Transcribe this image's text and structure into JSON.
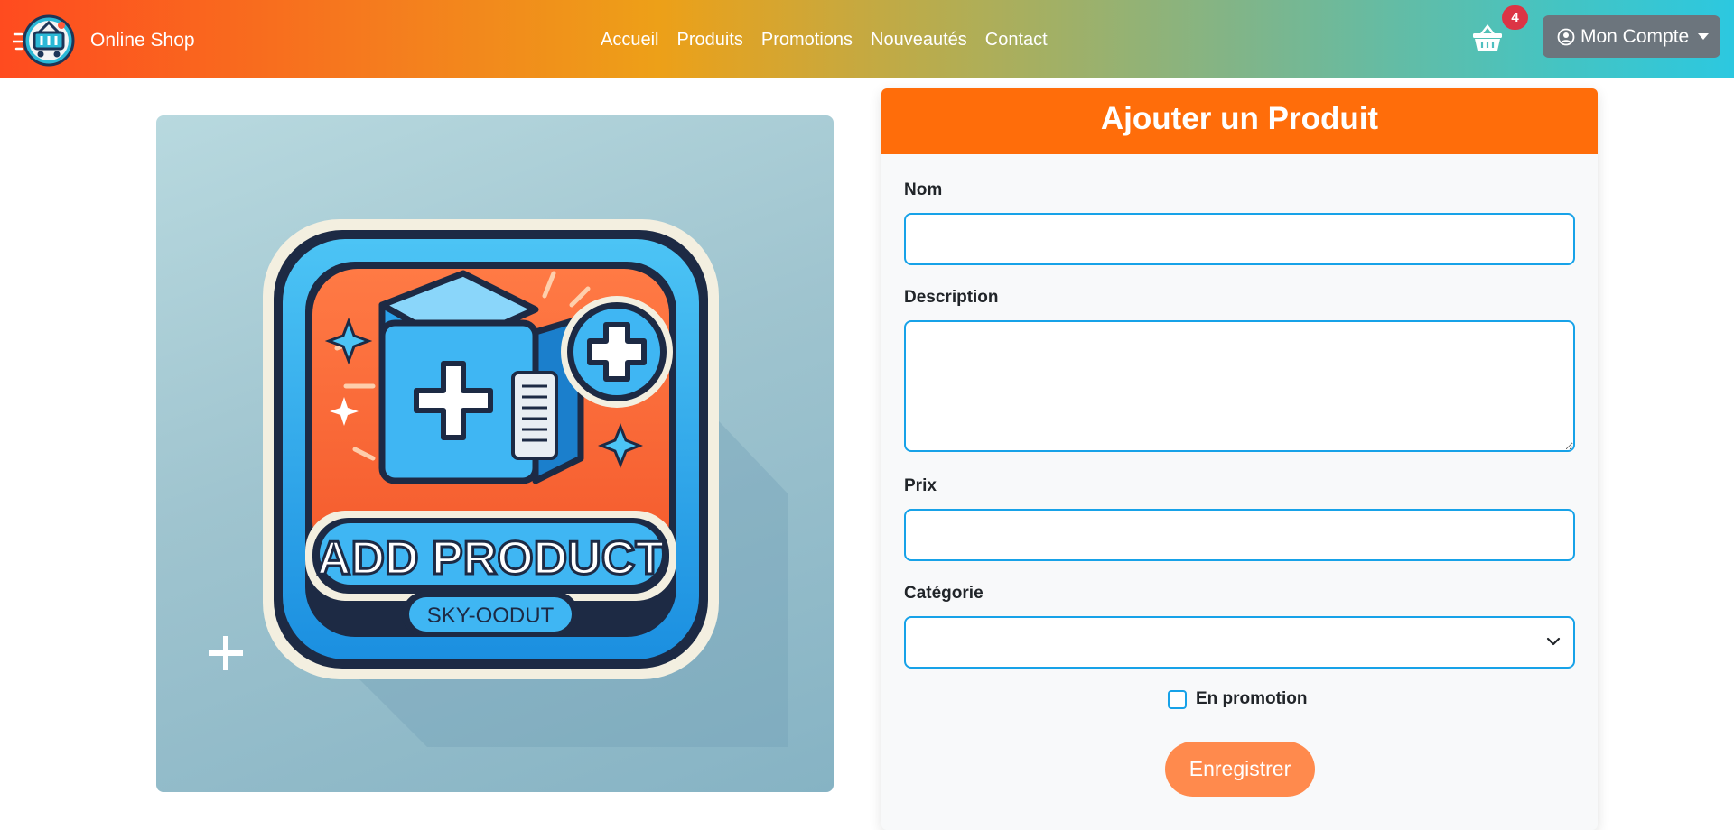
{
  "brand": {
    "name": "Online Shop",
    "logo_icon": "shopping-basket-logo"
  },
  "nav": {
    "links": [
      "Accueil",
      "Produits",
      "Promotions",
      "Nouveautés",
      "Contact"
    ]
  },
  "cart": {
    "icon": "basket-icon",
    "count": "4"
  },
  "account": {
    "label": "Mon Compte",
    "icon": "user-circle-icon"
  },
  "hero": {
    "title_text": "ADD PRODUCT",
    "sub_text": "SKY-OODUT",
    "alt": "Add product illustration"
  },
  "form": {
    "title": "Ajouter un Produit",
    "fields": {
      "name_label": "Nom",
      "name_value": "",
      "description_label": "Description",
      "description_value": "",
      "price_label": "Prix",
      "price_value": "",
      "category_label": "Catégorie",
      "category_value": ""
    },
    "promo_label": "En promotion",
    "promo_checked": false,
    "submit_label": "Enregistrer"
  },
  "colors": {
    "header": "#ff6d0a",
    "submit": "#ff8a4d",
    "input_border": "#17a2e8",
    "badge": "#dc3545",
    "account_btn": "#6c757d"
  }
}
